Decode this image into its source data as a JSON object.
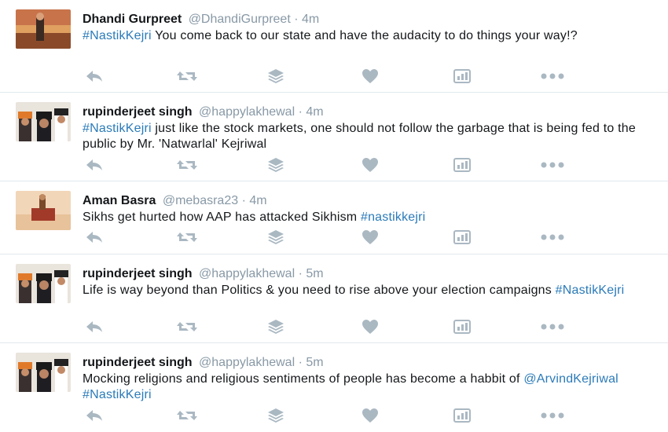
{
  "colors": {
    "link": "#2b7bb9",
    "muted": "#8899a6",
    "icon": "#aab8c2",
    "divider": "#e1e8ed"
  },
  "icons": [
    "reply-icon",
    "retweet-icon",
    "stack-icon",
    "heart-icon",
    "analytics-icon",
    "more-icon"
  ],
  "tweets": [
    {
      "name": "Dhandi Gurpreet",
      "handle": "@DhandiGurpreet",
      "dot": "·",
      "time": "4m",
      "tag1": "#NastikKejri",
      "body1": "  You come back to our state and have the audacity to do things your way!?"
    },
    {
      "name": "rupinderjeet singh",
      "handle": "@happylakhewal",
      "dot": "·",
      "time": "4m",
      "tag1": "#NastikKejri",
      "body1": " just like the stock markets, one should not follow the garbage that is being fed to the public by Mr. 'Natwarlal'  Kejriwal"
    },
    {
      "name": "Aman Basra",
      "handle": "@mebasra23",
      "dot": "·",
      "time": "4m",
      "body1": "Sikhs get hurted how AAP has attacked Sikhism ",
      "tag1": "#nastikkejri"
    },
    {
      "name": "rupinderjeet singh",
      "handle": "@happylakhewal",
      "dot": "·",
      "time": "5m",
      "body1": "Life is way beyond than Politics & you need to rise above your election campaigns ",
      "tag1": "#NastikKejri"
    },
    {
      "name": "rupinderjeet singh",
      "handle": "@happylakhewal",
      "dot": "·",
      "time": "5m",
      "body1": "Mocking religions and religious sentiments of people has become a habbit of ",
      "tag1": "@ArvindKejriwal",
      "body2": " ",
      "tag2": "#NastikKejri"
    }
  ]
}
